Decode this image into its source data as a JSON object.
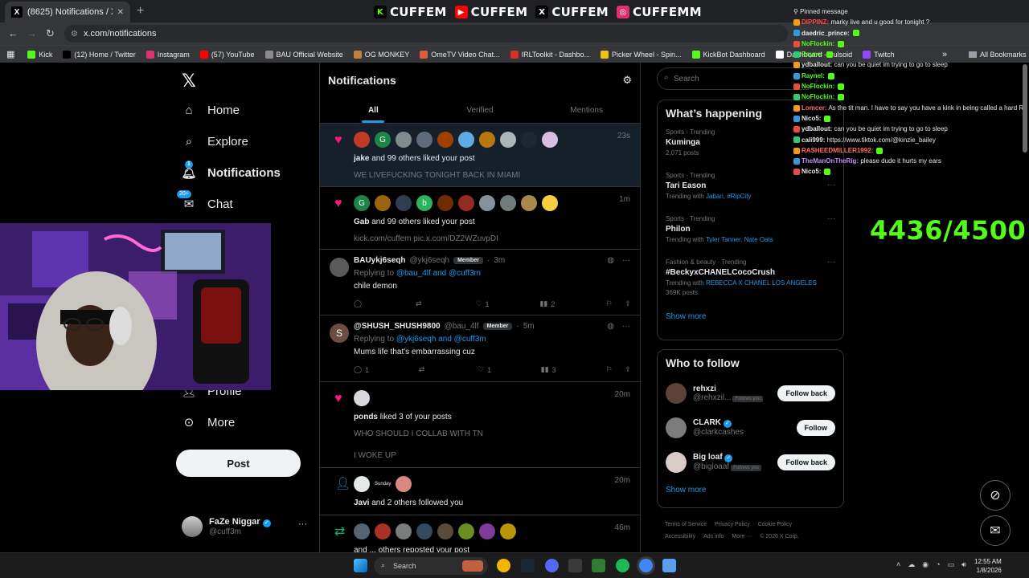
{
  "browser": {
    "tab_title": "(8625) Notifications / X",
    "tab_close": "✕",
    "new_tab": "+",
    "url": "x.com/notifications",
    "bookmarks": [
      {
        "label": "Kick",
        "color": "#53fc18"
      },
      {
        "label": "(12) Home / Twitter",
        "color": "#000000"
      },
      {
        "label": "Instagram",
        "color": "#e1306c"
      },
      {
        "label": "(57) YouTube",
        "color": "#ff0000"
      },
      {
        "label": "BAU Official Website",
        "color": "#8a8a8a"
      },
      {
        "label": "OG MONKEY",
        "color": "#c08040"
      },
      {
        "label": "OmeTV Video Chat...",
        "color": "#e05a3a"
      },
      {
        "label": "IRLToolkit - Dashbo...",
        "color": "#d93025"
      },
      {
        "label": "Picker Wheel - Spin...",
        "color": "#f4c20d"
      },
      {
        "label": "KickBot Dashboard",
        "color": "#53fc18"
      },
      {
        "label": "Dashboard - Pulsoid",
        "color": "#ffffff"
      },
      {
        "label": "Twitch",
        "color": "#9146ff"
      }
    ],
    "all_bookmarks": "All Bookmarks"
  },
  "banner": {
    "items": [
      {
        "icon": "K",
        "text": "CUFFEM",
        "color": "#53fc18"
      },
      {
        "icon": "▶",
        "text": "CUFFEM",
        "color": "#ff0000"
      },
      {
        "icon": "X",
        "text": "CUFFEM",
        "color": "#000000"
      },
      {
        "icon": "◎",
        "text": "CUFFEMM",
        "color": "#e1306c"
      }
    ]
  },
  "x_nav": {
    "items": [
      {
        "label": "Home",
        "icon": "home-icon"
      },
      {
        "label": "Explore",
        "icon": "search-icon"
      },
      {
        "label": "Notifications",
        "icon": "bell-icon",
        "badge": "1"
      },
      {
        "label": "Chat",
        "icon": "mail-icon",
        "badge": "20+"
      },
      {
        "label": "Profile",
        "icon": "person-icon"
      },
      {
        "label": "More",
        "icon": "more-icon"
      }
    ],
    "post_label": "Post",
    "account": {
      "name": "FaZe Niggar",
      "handle": "@cuff3m"
    }
  },
  "main": {
    "title": "Notifications",
    "tabs": [
      "All",
      "Verified",
      "Mentions"
    ],
    "notifications": [
      {
        "type": "like",
        "time": "23s",
        "text_bold": "jake",
        "text": " and 99 others liked your post",
        "sub": "WE LIVEFUCKING TONIGHT BACK IN MIAMI"
      },
      {
        "type": "like",
        "time": "1m",
        "text_bold": "Gab",
        "text": " and 99 others liked your post",
        "sub": "kick.com/cuffem pic.x.com/DZ2WZuvpDI"
      },
      {
        "type": "tweet",
        "name": "BAUykj6seqh",
        "handle": "@ykj6seqh",
        "badge": "Member",
        "time": "3m",
        "reply_prefix": "Replying to ",
        "reply_to": "@bau_4lf and @cuff3m",
        "body": "chile demon",
        "stats": {
          "replies": "",
          "reposts": "",
          "likes": "1",
          "views": "2"
        }
      },
      {
        "type": "tweet",
        "name": "@SHUSH_SHUSH9800",
        "handle": "@bau_4lf",
        "badge": "Member",
        "time": "5m",
        "reply_prefix": "Replying to ",
        "reply_to": "@ykj6seqh and @cuff3m",
        "body": "Mums life that's embarrassing cuz",
        "stats": {
          "replies": "1",
          "reposts": "",
          "likes": "1",
          "views": "3"
        }
      },
      {
        "type": "like",
        "time": "20m",
        "text_bold": "ponds",
        "text": " liked 3 of your posts",
        "sub": "WHO SHOULD I COLLAB WITH TN",
        "sub2": "I WOKE UP"
      },
      {
        "type": "follow",
        "time": "20m",
        "text_bold": "Javi",
        "text": " and 2 others followed you",
        "mini": "Sunday"
      },
      {
        "type": "repost",
        "time": "46m",
        "text": "and ... others reposted your post"
      }
    ]
  },
  "right": {
    "search_placeholder": "Search",
    "happening_title": "What’s happening",
    "trends": [
      {
        "category": "Sports · Trending",
        "title": "Kuminga",
        "meta": "2,071 posts"
      },
      {
        "category": "Sports · Trending",
        "title": "Tari Eason",
        "with_prefix": "Trending with ",
        "with": "Jabari, #RipCity"
      },
      {
        "category": "Sports · Trending",
        "title": "Philon",
        "with_prefix": "Trending with ",
        "with": "Tyler Tanner, Nate Oats"
      },
      {
        "category": "Fashion & beauty · Trending",
        "title": "#BeckyxCHANELCocoCrush",
        "with_prefix": "Trending with ",
        "with": "REBECCA X CHANEL LOS ANGELES",
        "meta": "369K posts"
      }
    ],
    "show_more": "Show more",
    "wtf_title": "Who to follow",
    "who_to_follow": [
      {
        "name": "rehxzi",
        "handle": "@rehxzil...",
        "follows_you": "Follows you",
        "button": "Follow back",
        "verified": false
      },
      {
        "name": "CLARK",
        "handle": "@clarkcashes",
        "follows_you": "",
        "button": "Follow",
        "verified": true
      },
      {
        "name": "Big loaf",
        "handle": "@bigloaaf",
        "follows_you": "Follows you",
        "button": "Follow back",
        "verified": true
      }
    ],
    "footer": [
      "Terms of Service",
      "Privacy Policy",
      "Cookie Policy",
      "Accessibility",
      "Ads info",
      "More ···",
      "© 2026 X Corp."
    ]
  },
  "chat": {
    "pinned": "Pinned message",
    "lines": [
      {
        "user": "DIPPINZ:",
        "color": "#ff4d4d",
        "text": " marky live and u good for tonight ?"
      },
      {
        "user": "daedric_prince:",
        "color": "#e7e9ea",
        "text": ""
      },
      {
        "user": "NoFlockin:",
        "color": "#53fc18",
        "text": ""
      },
      {
        "user": "Rayne:",
        "color": "#53fc18",
        "text": ""
      },
      {
        "user": "ydballout:",
        "color": "#e7e9ea",
        "text": " can you be quiet im trying to go to sleep"
      },
      {
        "user": "Raynel:",
        "color": "#53fc18",
        "text": ""
      },
      {
        "user": "NoFlockin:",
        "color": "#53fc18",
        "text": ""
      },
      {
        "user": "NoFlockin:",
        "color": "#53fc18",
        "text": ""
      },
      {
        "user": "Lomcer:",
        "color": "#ff6b6b",
        "text": " As the tit man. I have to say you have a kink in being called a hard R"
      },
      {
        "user": "Nico5:",
        "color": "#e7e9ea",
        "text": ""
      },
      {
        "user": "ydballout:",
        "color": "#e7e9ea",
        "text": " can you be quiet im trying to go to sleep"
      },
      {
        "user": "cali999:",
        "color": "#e7e9ea",
        "text": " https://www.tiktok.com/@kinzie_bailey"
      },
      {
        "user": "RASHEEDMILLER1992:",
        "color": "#ff6b6b",
        "text": ""
      },
      {
        "user": "TheManOnTheRig:",
        "color": "#c38cff",
        "text": " please dude it hurts my ears"
      },
      {
        "user": "Nico5:",
        "color": "#e7e9ea",
        "text": ""
      }
    ]
  },
  "counter": "4436/4500",
  "taskbar": {
    "search": "Search",
    "time": "12:55 AM",
    "date": "1/8/2026"
  }
}
